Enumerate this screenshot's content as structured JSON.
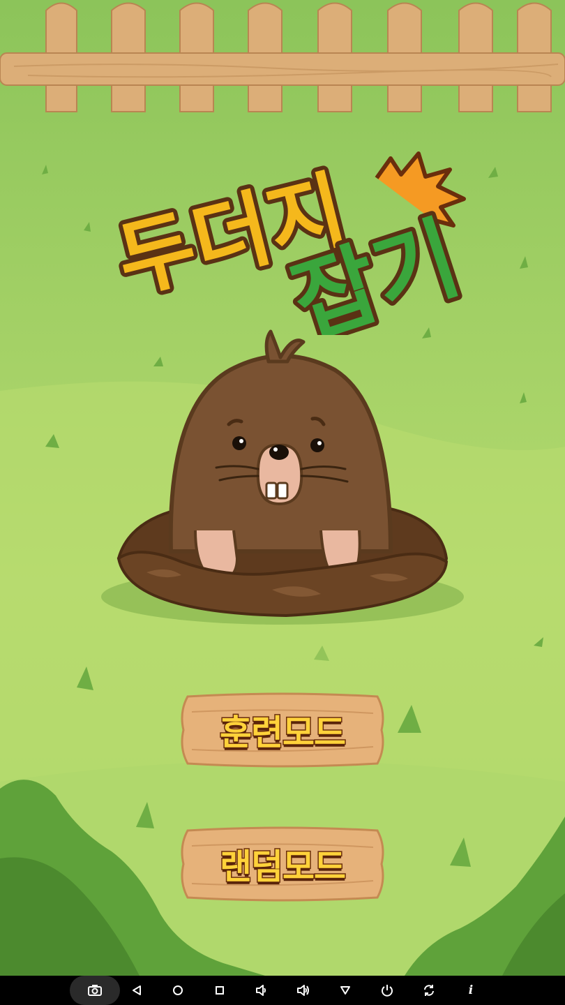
{
  "game": {
    "title_line1": "두더지",
    "title_line2": "잡기",
    "buttons": {
      "training_mode": "훈련모드",
      "random_mode": "랜덤모드"
    },
    "colors": {
      "title_yellow": "#f5b81c",
      "title_green": "#3aa63c",
      "outline": "#5a3214",
      "wood": "#e6b27a",
      "mole": "#7a5232",
      "grass": "#a4d166"
    }
  },
  "navbar": {
    "icons": [
      "screenshot-icon",
      "back-icon",
      "home-icon",
      "recents-icon",
      "volume-down-icon",
      "volume-up-icon",
      "dropdown-icon",
      "power-icon",
      "rotate-icon",
      "info-icon"
    ],
    "info_glyph": "i"
  }
}
